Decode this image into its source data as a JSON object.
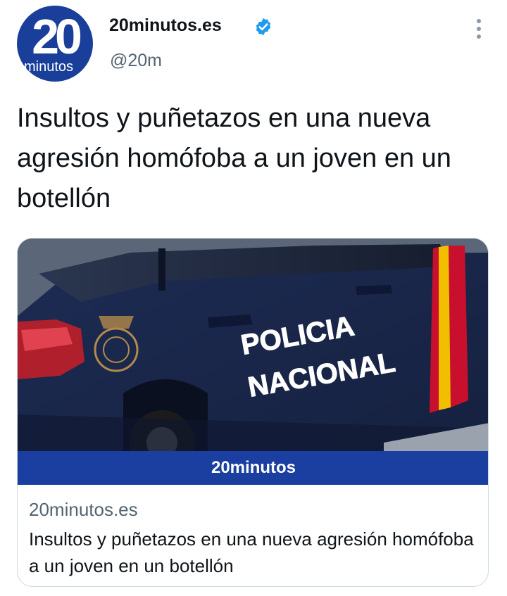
{
  "account": {
    "avatar_number": "20",
    "avatar_word": "minutos",
    "display_name": "20minutos.es",
    "handle": "@20m",
    "verified_icon": "verified-badge-icon",
    "more_icon": "more-vertical-icon"
  },
  "tweet": {
    "text": "Insultos y puñetazos en una nueva agresión homófoba a un joven en un botellón"
  },
  "card": {
    "image_text_line1": "POLICIA",
    "image_text_line2": "NACIONAL",
    "brand_label": "20minutos",
    "domain": "20minutos.es",
    "title": "Insultos y puñetazos en una nueva agresión homófoba a un joven en un botellón"
  },
  "colors": {
    "brand_blue": "#1b3fa0",
    "verified_blue": "#1d9bf0",
    "secondary_text": "#536471"
  }
}
